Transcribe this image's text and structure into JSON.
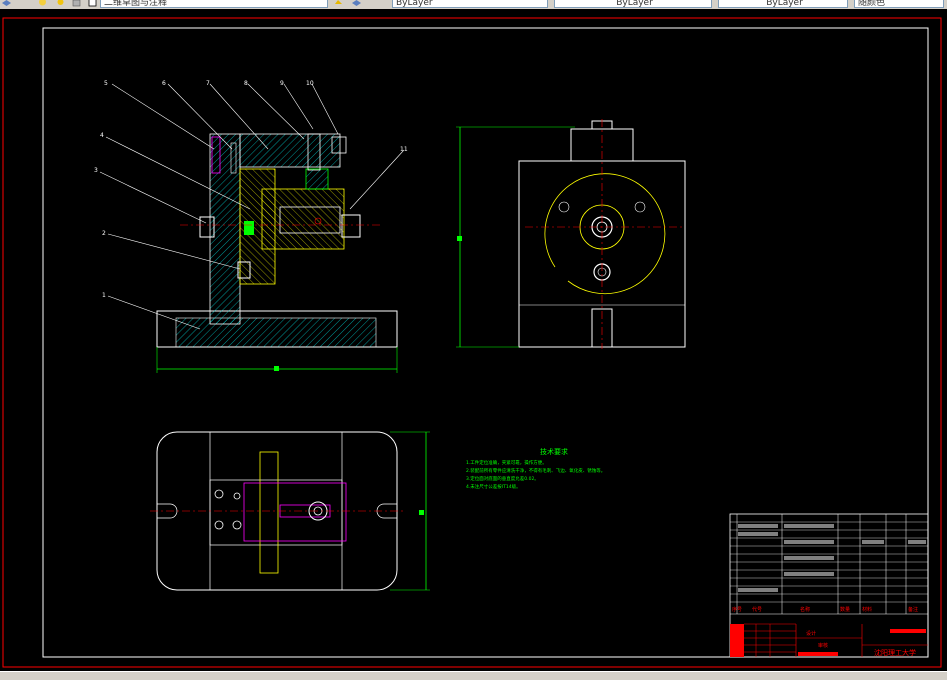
{
  "toolbar": {
    "workspace_label": "二维草图与注释",
    "layer_combo": "ByLayer",
    "linetype_combo": "ByLayer",
    "lineweight_combo": "ByLayer",
    "plotstyle_combo": "随颜色"
  },
  "drawing": {
    "tech_title": "技术要求",
    "tech_lines": [
      "1.工件定位准确，夹紧可靠，操作方便。",
      "2.装配前所有零件应清洗干净，不得有毛刺、飞边、氧化皮、锈蚀等。",
      "3.定位面对底面的垂直度允差0.02。",
      "4.未注尺寸公差按IT14级。"
    ],
    "part_numbers": [
      "5",
      "6",
      "7",
      "8",
      "9",
      "10",
      "4",
      "3",
      "2",
      "1",
      "11"
    ],
    "title_block": {
      "design_label": "设计",
      "check_label": "审核",
      "material_label": "材料",
      "school": "沈阳理工大学",
      "seq_label": "序号",
      "code_label": "代号",
      "name_label": "名称",
      "qty_label": "数量",
      "note_label": "备注"
    }
  },
  "colors": {
    "canvas": "#000000",
    "white_line": "#ffffff",
    "red_frame": "#ff0000",
    "yellow_part": "#ffff00",
    "green_dim": "#00ff00",
    "magenta_part": "#ff00ff",
    "cyan_hatch": "#00ffff"
  }
}
